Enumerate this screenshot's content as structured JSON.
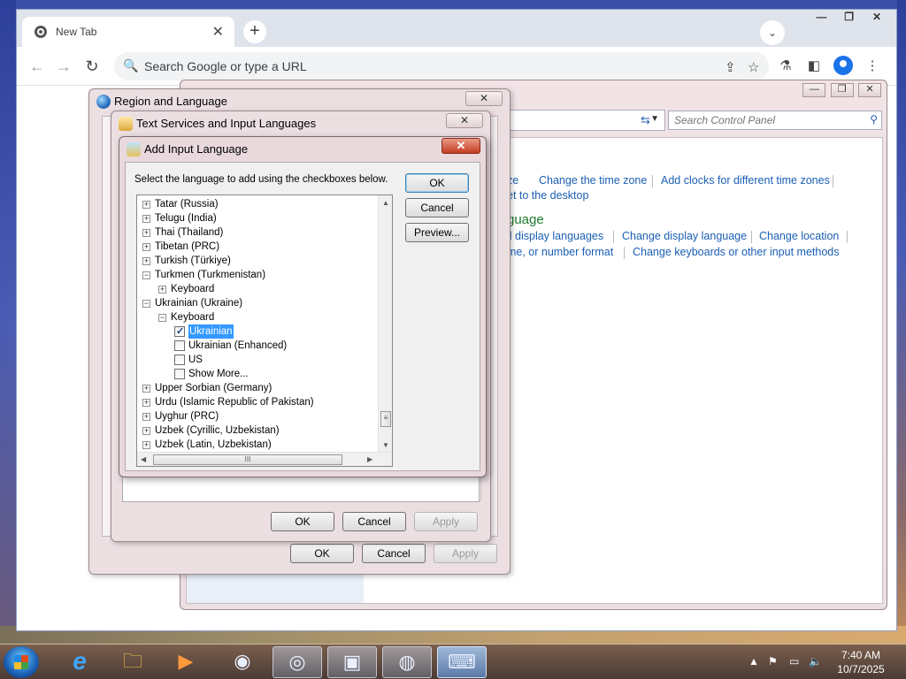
{
  "browser": {
    "tab_title": "New Tab",
    "tab_close": "✕",
    "new_tab": "+",
    "omnibox_placeholder": "Search Google or type a URL",
    "win_minimize": "—",
    "win_restore": "❐",
    "win_close": "✕"
  },
  "control_panel": {
    "search_placeholder": "Search Control Panel",
    "links": {
      "time_zone_partial": "ze",
      "change_time_zone": "Change the time zone",
      "add_clocks": "Add clocks for different time zones",
      "set_desktop_partial": "et to the desktop",
      "heading_partial": "guage",
      "display_langs_partial": "ll display languages",
      "change_display_language": "Change display language",
      "change_location": "Change location",
      "number_format_partial": "me, or number format",
      "change_keyboards": "Change keyboards or other input methods"
    },
    "buttons": {
      "ok": "OK",
      "cancel": "Cancel",
      "apply": "Apply"
    }
  },
  "region_dialog": {
    "title": "Region and Language",
    "close": "✕",
    "buttons": {
      "ok": "OK",
      "cancel": "Cancel",
      "apply": "Apply"
    }
  },
  "text_services_dialog": {
    "title": "Text Services and Input Languages",
    "close": "✕",
    "buttons": {
      "ok": "OK",
      "cancel": "Cancel",
      "apply": "Apply"
    }
  },
  "add_input_language": {
    "title": "Add Input Language",
    "close": "✕",
    "instruction": "Select the language to add using the checkboxes below.",
    "buttons": {
      "ok": "OK",
      "cancel": "Cancel",
      "preview": "Preview..."
    },
    "tree": [
      {
        "label": "Tatar (Russia)",
        "level": 0,
        "type": "node",
        "expanded": false
      },
      {
        "label": "Telugu (India)",
        "level": 0,
        "type": "node",
        "expanded": false
      },
      {
        "label": "Thai (Thailand)",
        "level": 0,
        "type": "node",
        "expanded": false
      },
      {
        "label": "Tibetan (PRC)",
        "level": 0,
        "type": "node",
        "expanded": false
      },
      {
        "label": "Turkish (Türkiye)",
        "level": 0,
        "type": "node",
        "expanded": false
      },
      {
        "label": "Turkmen (Turkmenistan)",
        "level": 0,
        "type": "node",
        "expanded": true
      },
      {
        "label": "Keyboard",
        "level": 1,
        "type": "node",
        "expanded": false
      },
      {
        "label": "Ukrainian (Ukraine)",
        "level": 0,
        "type": "node",
        "expanded": true
      },
      {
        "label": "Keyboard",
        "level": 1,
        "type": "node",
        "expanded": true
      },
      {
        "label": "Ukrainian",
        "level": 2,
        "type": "check",
        "checked": true,
        "selected": true
      },
      {
        "label": "Ukrainian (Enhanced)",
        "level": 2,
        "type": "check",
        "checked": false
      },
      {
        "label": "US",
        "level": 2,
        "type": "check",
        "checked": false
      },
      {
        "label": "Show More...",
        "level": 2,
        "type": "check",
        "checked": false
      },
      {
        "label": "Upper Sorbian (Germany)",
        "level": 0,
        "type": "node",
        "expanded": false
      },
      {
        "label": "Urdu (Islamic Republic of Pakistan)",
        "level": 0,
        "type": "node",
        "expanded": false
      },
      {
        "label": "Uyghur (PRC)",
        "level": 0,
        "type": "node",
        "expanded": false
      },
      {
        "label": "Uzbek (Cyrillic, Uzbekistan)",
        "level": 0,
        "type": "node",
        "expanded": false
      },
      {
        "label": "Uzbek (Latin, Uzbekistan)",
        "level": 0,
        "type": "node",
        "expanded": false
      }
    ],
    "scroll_grip": "III"
  },
  "taskbar": {
    "items": [
      {
        "name": "internet-explorer-icon",
        "glyph": "e"
      },
      {
        "name": "file-explorer-icon",
        "glyph": "🗀"
      },
      {
        "name": "media-player-icon",
        "glyph": "▶"
      },
      {
        "name": "chrome-icon",
        "glyph": "◉"
      },
      {
        "name": "control-panel-icon",
        "glyph": "◎"
      },
      {
        "name": "network-window-icon",
        "glyph": "▣"
      },
      {
        "name": "region-language-icon",
        "glyph": "◍"
      },
      {
        "name": "keyboard-language-icon",
        "glyph": "⌨"
      }
    ],
    "time": "7:40 AM",
    "date": "10/7/2025"
  },
  "colors": {
    "link": "#1a5fb4",
    "heading_green": "#1e7a2e",
    "selection": "#3399ff"
  }
}
